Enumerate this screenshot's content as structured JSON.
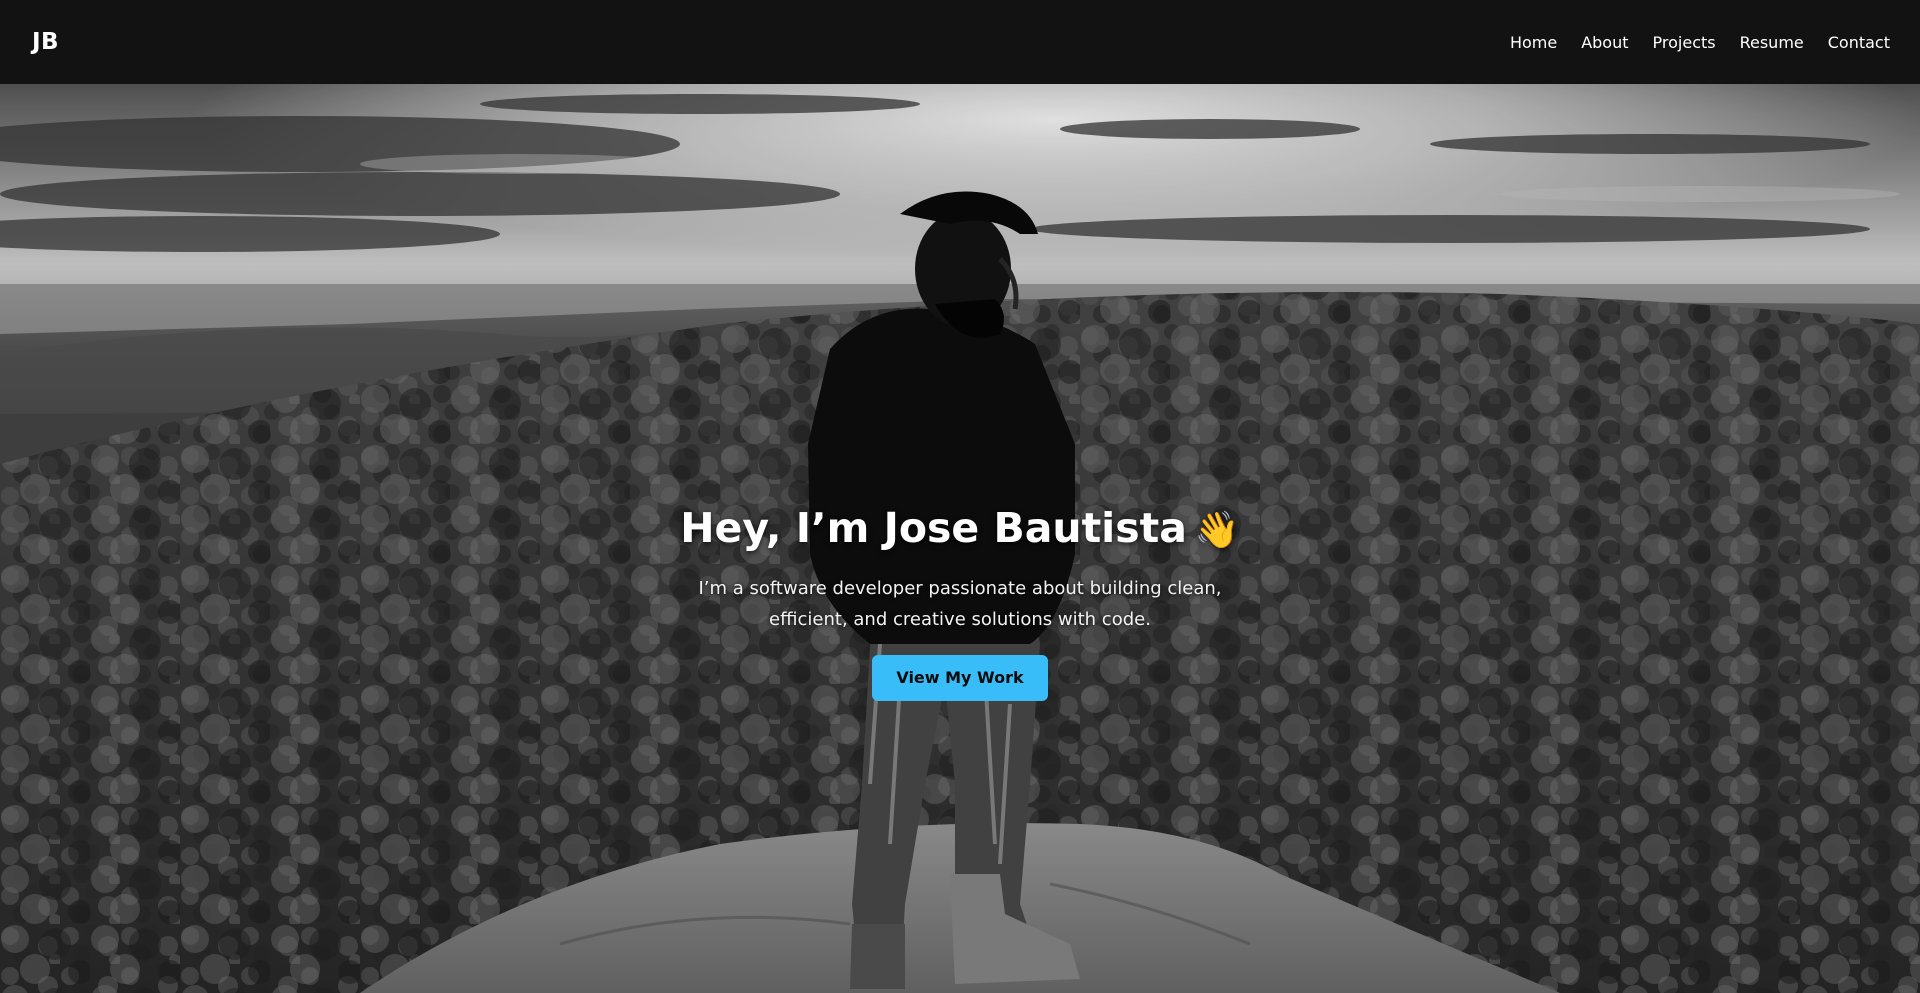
{
  "nav": {
    "logo": "JB",
    "links": [
      "Home",
      "About",
      "Projects",
      "Resume",
      "Contact"
    ]
  },
  "hero": {
    "title": "Hey, I’m Jose Bautista",
    "wave_emoji": "👋",
    "subtitle": "I’m a software developer passionate about building clean, efficient, and creative solutions with code.",
    "cta_label": "View My Work",
    "background_description": "black-and-white landscape photo: a person standing on a rock outcrop overlooking a forested valley under a cloudy sky"
  },
  "colors": {
    "navbar_bg": "#121212",
    "cta_bg": "#38bdf8",
    "text": "#ffffff"
  }
}
